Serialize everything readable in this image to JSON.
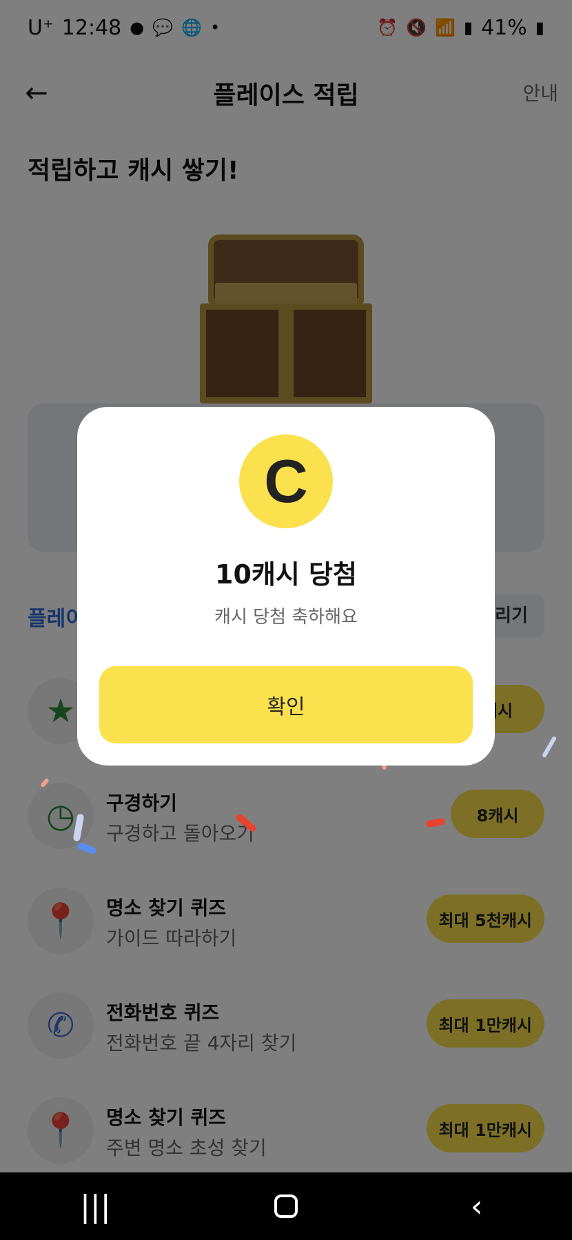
{
  "status_bar": {
    "carrier": "U⁺",
    "time": "12:48",
    "left_icons": [
      "sync-icon",
      "talk-icon",
      "globe-icon",
      "dot-icon"
    ],
    "right_icons": [
      "alarm-icon",
      "mute-icon",
      "wifi-icon",
      "signal-icon"
    ],
    "battery": "41%"
  },
  "header": {
    "title": "플레이스 적립",
    "guide_label": "안내"
  },
  "hero": {
    "title": "적립하고 캐시 쌓기!"
  },
  "section": {
    "title": "플레이",
    "side_button": "늘리기"
  },
  "tasks": [
    {
      "icon": "star-icon",
      "title": "",
      "subtitle": "",
      "reward": "캐시"
    },
    {
      "icon": "clock-icon",
      "title": "구경하기",
      "subtitle": "구경하고 돌아오기",
      "reward": "8캐시"
    },
    {
      "icon": "map-pin-face-icon",
      "title": "명소 찾기 퀴즈",
      "subtitle": "가이드 따라하기",
      "reward": "최대 5천캐시"
    },
    {
      "icon": "phone-icon",
      "title": "전화번호 퀴즈",
      "subtitle": "전화번호 끝 4자리 찾기",
      "reward": "최대 1만캐시"
    },
    {
      "icon": "map-pin-icon",
      "title": "명소 찾기 퀴즈",
      "subtitle": "주변 명소 초성 찾기",
      "reward": "최대 1만캐시"
    }
  ],
  "modal": {
    "coin_letter": "C",
    "title": "10캐시 당첨",
    "subtitle": "캐시 당첨 축하해요",
    "confirm_label": "확인"
  },
  "colors": {
    "accent_yellow": "#fbe14d",
    "section_blue": "#2f6ad9",
    "star_green": "#2e8b3a",
    "icon_blue": "#3f6fd1"
  }
}
